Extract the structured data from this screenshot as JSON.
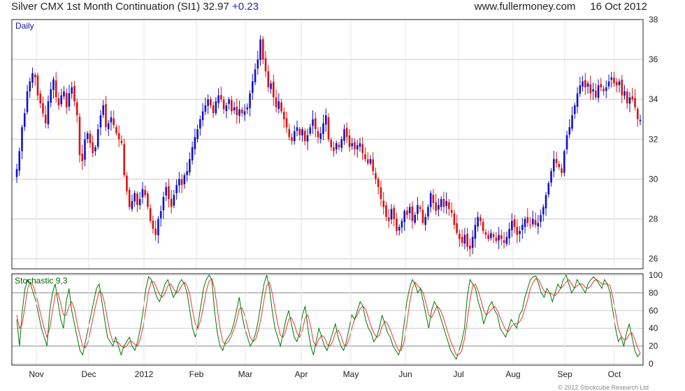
{
  "header": {
    "title": "Silver CMX 1st Month Continuation (SI1)",
    "last": "32.97",
    "change": "+0.23",
    "site": "www.fullermoney.com",
    "date": "16 Oct 2012"
  },
  "copyright": "© 2012 Stockcube Research Ltd",
  "colors": {
    "up": "#1111cc",
    "down": "#dd1111",
    "k_line": "#007700",
    "d_line": "#ee3333",
    "grid": "#cccccc",
    "frame": "#222222"
  },
  "chart_data": [
    {
      "type": "candlestick",
      "label": "Daily",
      "ylim": [
        25.5,
        38
      ],
      "yticks": [
        26,
        28,
        30,
        32,
        34,
        36,
        38
      ],
      "xlabels": [
        "Nov",
        "Dec",
        "2012",
        "Feb",
        "Mar",
        "Apr",
        "May",
        "Jun",
        "Jul",
        "Aug",
        "Sep",
        "Oct"
      ],
      "grid": true,
      "last_close": 32.97,
      "closes": [
        30.5,
        31.4,
        32.6,
        33.3,
        34.4,
        34.9,
        35.3,
        35.1,
        34.2,
        33.8,
        33.3,
        32.8,
        33.9,
        34.5,
        35.0,
        34.1,
        33.7,
        34.2,
        34.4,
        33.6,
        34.3,
        34.6,
        33.9,
        33.2,
        31.2,
        30.9,
        32.0,
        32.3,
        31.8,
        31.3,
        31.6,
        32.5,
        33.2,
        33.7,
        32.6,
        32.8,
        33.1,
        32.7,
        32.3,
        32.0,
        31.8,
        30.2,
        29.4,
        28.6,
        28.9,
        29.3,
        28.7,
        29.0,
        29.5,
        29.2,
        28.6,
        27.9,
        27.5,
        27.2,
        28.0,
        28.4,
        29.1,
        29.6,
        29.0,
        28.6,
        29.2,
        29.7,
        30.0,
        29.7,
        30.2,
        30.4,
        31.0,
        31.6,
        32.1,
        32.5,
        33.0,
        33.4,
        33.7,
        34.0,
        33.7,
        33.3,
        33.9,
        34.2,
        34.0,
        33.5,
        33.7,
        34.0,
        33.4,
        33.6,
        33.2,
        33.5,
        33.3,
        33.4,
        33.6,
        34.3,
        34.9,
        35.5,
        36.0,
        37.0,
        36.0,
        35.4,
        34.6,
        34.8,
        34.1,
        33.6,
        33.9,
        33.4,
        33.0,
        32.6,
        32.1,
        31.9,
        32.4,
        32.6,
        32.2,
        32.5,
        31.9,
        32.2,
        32.6,
        33.0,
        32.5,
        32.1,
        32.3,
        32.8,
        33.2,
        32.0,
        31.6,
        31.4,
        31.8,
        31.6,
        32.0,
        32.5,
        32.1,
        31.6,
        31.8,
        31.5,
        31.7,
        31.8,
        31.3,
        31.0,
        30.8,
        31.0,
        30.4,
        30.0,
        29.6,
        29.0,
        28.6,
        28.1,
        27.9,
        28.5,
        28.0,
        27.4,
        27.6,
        27.9,
        28.4,
        28.2,
        28.6,
        27.9,
        28.2,
        28.7,
        28.5,
        27.8,
        28.1,
        28.6,
        29.3,
        28.8,
        28.4,
        28.7,
        29.0,
        28.6,
        28.9,
        28.5,
        28.3,
        27.7,
        27.3,
        27.0,
        26.8,
        27.2,
        26.6,
        26.5,
        27.1,
        27.7,
        28.1,
        27.9,
        27.4,
        27.2,
        27.0,
        27.3,
        27.1,
        26.9,
        27.2,
        27.0,
        26.8,
        27.1,
        27.5,
        27.9,
        27.6,
        27.2,
        27.4,
        27.7,
        28.0,
        27.8,
        27.7,
        28.0,
        27.7,
        27.8,
        28.2,
        28.6,
        29.2,
        29.8,
        30.4,
        31.0,
        30.8,
        30.6,
        30.3,
        31.4,
        32.2,
        32.6,
        33.2,
        33.7,
        34.3,
        34.7,
        34.9,
        34.6,
        34.8,
        34.3,
        34.5,
        34.1,
        34.7,
        34.6,
        34.4,
        34.6,
        34.9,
        35.1,
        34.8,
        34.7,
        34.9,
        34.2,
        34.4,
        33.8,
        34.1,
        34.0,
        33.6,
        33.0,
        32.97
      ],
      "description_of_values": "approximate daily closes read from the price axis"
    },
    {
      "type": "line",
      "label": "Stochastic 9,3",
      "ylim": [
        0,
        100
      ],
      "yticks": [
        0,
        20,
        40,
        60,
        80,
        100
      ],
      "reference_lines": [
        20,
        80
      ],
      "series": [
        {
          "name": "%K",
          "values": [
            50,
            20,
            60,
            85,
            95,
            90,
            80,
            70,
            55,
            40,
            30,
            20,
            60,
            80,
            90,
            70,
            50,
            40,
            70,
            85,
            60,
            45,
            30,
            15,
            10,
            25,
            40,
            55,
            70,
            85,
            90,
            70,
            50,
            30,
            25,
            20,
            30,
            20,
            10,
            20,
            25,
            30,
            20,
            15,
            25,
            40,
            60,
            85,
            98,
            95,
            85,
            75,
            70,
            80,
            90,
            95,
            85,
            75,
            80,
            90,
            95,
            90,
            80,
            60,
            40,
            30,
            45,
            65,
            85,
            95,
            100,
            95,
            60,
            35,
            20,
            15,
            25,
            30,
            35,
            45,
            60,
            75,
            55,
            40,
            30,
            20,
            25,
            35,
            50,
            70,
            90,
            100,
            85,
            60,
            40,
            30,
            20,
            35,
            50,
            60,
            45,
            30,
            25,
            35,
            55,
            65,
            40,
            20,
            10,
            25,
            40,
            30,
            20,
            15,
            25,
            35,
            45,
            30,
            20,
            15,
            25,
            40,
            55,
            50,
            60,
            70,
            65,
            50,
            40,
            35,
            25,
            30,
            40,
            55,
            45,
            35,
            30,
            20,
            15,
            10,
            20,
            45,
            70,
            85,
            95,
            90,
            80,
            85,
            70,
            55,
            40,
            60,
            70,
            65,
            55,
            45,
            35,
            25,
            15,
            10,
            5,
            15,
            25,
            40,
            75,
            95,
            90,
            85,
            70,
            60,
            45,
            55,
            65,
            70,
            60,
            55,
            40,
            35,
            30,
            40,
            50,
            45,
            40,
            55,
            60,
            75,
            85,
            95,
            98,
            99,
            90,
            80,
            75,
            85,
            80,
            70,
            80,
            90,
            85,
            95,
            100,
            90,
            80,
            85,
            95,
            90,
            85,
            80,
            90,
            95,
            98,
            95,
            90,
            85,
            95,
            90,
            80,
            60,
            40,
            25,
            30,
            20,
            35,
            45,
            30,
            15,
            8,
            12
          ]
        },
        {
          "name": "%D",
          "values": [
            55,
            40,
            45,
            65,
            85,
            92,
            88,
            78,
            65,
            52,
            40,
            30,
            40,
            60,
            78,
            80,
            68,
            55,
            55,
            65,
            70,
            62,
            45,
            32,
            20,
            18,
            25,
            40,
            55,
            70,
            82,
            80,
            68,
            50,
            35,
            25,
            25,
            24,
            20,
            18,
            20,
            25,
            25,
            22,
            20,
            28,
            42,
            62,
            82,
            93,
            92,
            85,
            78,
            75,
            80,
            88,
            90,
            85,
            80,
            82,
            88,
            92,
            88,
            78,
            60,
            45,
            40,
            50,
            65,
            82,
            93,
            96,
            85,
            62,
            40,
            25,
            22,
            25,
            30,
            38,
            48,
            62,
            63,
            55,
            42,
            30,
            25,
            28,
            38,
            52,
            72,
            88,
            92,
            80,
            62,
            45,
            32,
            30,
            38,
            50,
            52,
            45,
            35,
            30,
            38,
            52,
            55,
            42,
            25,
            20,
            28,
            32,
            30,
            22,
            20,
            25,
            35,
            38,
            32,
            22,
            20,
            28,
            40,
            50,
            55,
            62,
            65,
            62,
            52,
            42,
            35,
            30,
            32,
            42,
            48,
            45,
            38,
            30,
            22,
            15,
            15,
            25,
            45,
            68,
            85,
            92,
            88,
            85,
            80,
            68,
            55,
            52,
            58,
            65,
            62,
            55,
            45,
            35,
            25,
            18,
            10,
            10,
            15,
            28,
            48,
            72,
            88,
            90,
            82,
            72,
            60,
            55,
            58,
            62,
            65,
            60,
            52,
            45,
            38,
            36,
            42,
            45,
            45,
            47,
            52,
            62,
            72,
            85,
            92,
            96,
            95,
            88,
            82,
            80,
            80,
            78,
            77,
            80,
            85,
            88,
            92,
            95,
            90,
            85,
            88,
            90,
            90,
            86,
            85,
            88,
            93,
            95,
            93,
            90,
            90,
            90,
            88,
            75,
            58,
            40,
            32,
            27,
            28,
            33,
            35,
            28,
            18,
            12
          ]
        }
      ]
    }
  ]
}
